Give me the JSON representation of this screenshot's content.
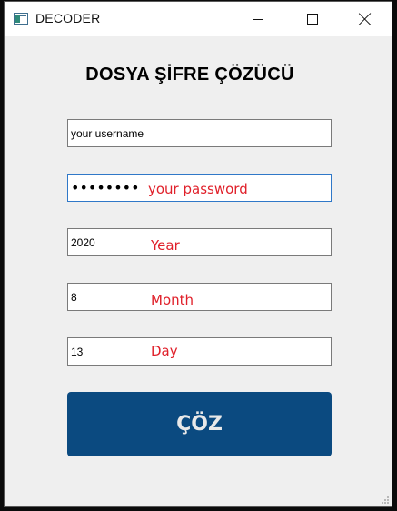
{
  "window": {
    "title": "DECODER",
    "icons": {
      "app": "app-window-icon",
      "minimize": "minimize-icon",
      "maximize": "maximize-icon",
      "close": "close-icon"
    }
  },
  "form": {
    "heading": "DOSYA ŞİFRE ÇÖZÜCÜ",
    "username": {
      "value": "your username"
    },
    "password": {
      "masked_value": "••••••••",
      "hint": "your password"
    },
    "year": {
      "value": "2020",
      "hint": "Year"
    },
    "month": {
      "value": "8",
      "hint": "Month"
    },
    "day": {
      "value": "13",
      "hint": "Day"
    },
    "submit_label": "ÇÖZ"
  },
  "colors": {
    "accent": "#0b4a80",
    "hint_text": "#e0202a",
    "focus_border": "#2f78c8"
  }
}
